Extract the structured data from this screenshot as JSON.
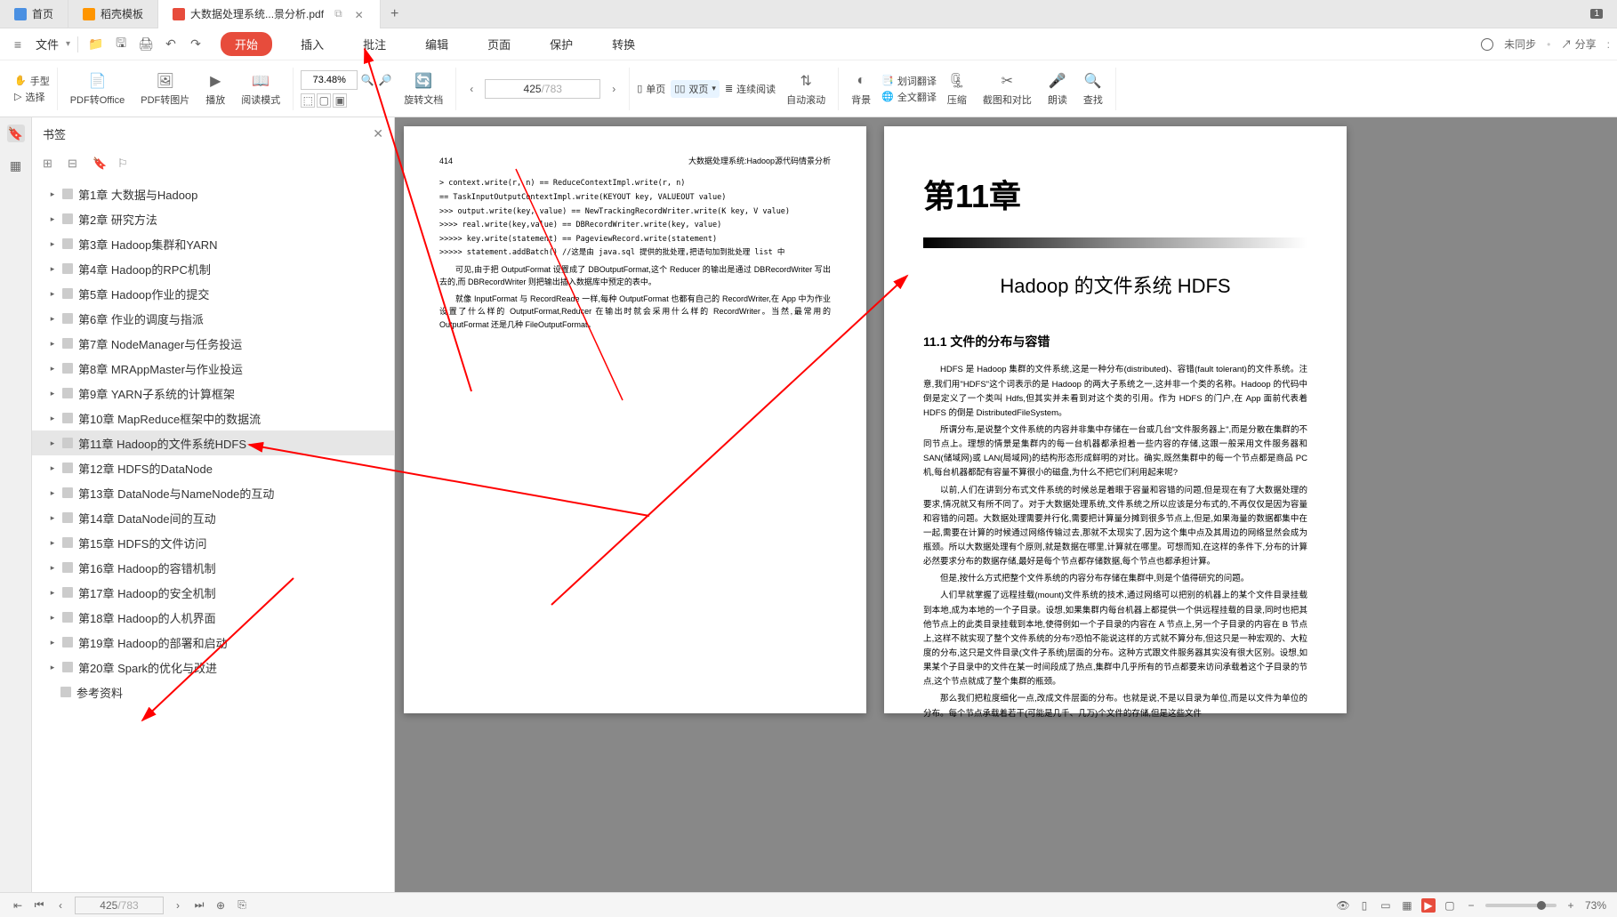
{
  "tabs": {
    "home": "首页",
    "template": "稻壳模板",
    "pdf": "大数据处理系统...景分析.pdf"
  },
  "menu": {
    "file": "文件",
    "tabs": [
      "开始",
      "插入",
      "批注",
      "编辑",
      "页面",
      "保护",
      "转换"
    ],
    "sync": "未同步",
    "share": "分享"
  },
  "toolbar": {
    "hand": "手型",
    "select": "选择",
    "pdf_to_office": "PDF转Office",
    "pdf_to_image": "PDF转图片",
    "play": "播放",
    "read_mode": "阅读模式",
    "zoom": "73.48%",
    "rotate": "旋转文档",
    "page_current": "425",
    "page_total": "/783",
    "single_page": "单页",
    "double_page": "双页",
    "continuous": "连续阅读",
    "auto_scroll": "自动滚动",
    "background": "背景",
    "word_translate": "划词翻译",
    "full_translate": "全文翻译",
    "compress": "压缩",
    "screenshot": "截图和对比",
    "read_aloud": "朗读",
    "find": "查找"
  },
  "bookmarks": {
    "title": "书签",
    "items": [
      "第1章  大数据与Hadoop",
      "第2章  研究方法",
      "第3章  Hadoop集群和YARN",
      "第4章  Hadoop的RPC机制",
      "第5章  Hadoop作业的提交",
      "第6章  作业的调度与指派",
      "第7章  NodeManager与任务投运",
      "第8章  MRAppMaster与作业投运",
      "第9章  YARN子系统的计算框架",
      "第10章  MapReduce框架中的数据流",
      "第11章  Hadoop的文件系统HDFS",
      "第12章  HDFS的DataNode",
      "第13章  DataNode与NameNode的互动",
      "第14章  DataNode间的互动",
      "第15章  HDFS的文件访问",
      "第16章  Hadoop的容错机制",
      "第17章  Hadoop的安全机制",
      "第18章  Hadoop的人机界面",
      "第19章  Hadoop的部署和启动",
      "第20章  Spark的优化与改进"
    ],
    "ref": "参考资料",
    "selected_index": 10
  },
  "pdf_left": {
    "page_num": "414",
    "header": "大数据处理系统:Hadoop源代码情景分析",
    "code": [
      "> context.write(r, n) == ReduceContextImpl.write(r, n)",
      "  == TaskInputOutputContextImpl.write(KEYOUT key, VALUEOUT value)",
      ">>> output.write(key, value) == NewTrackingRecordWriter.write(K key, V value)",
      ">>>> real.write(key,value) == DBRecordWriter.write(key, value)",
      ">>>>> key.write(statement) == PageviewRecord.write(statement)",
      ">>>>> statement.addBatch()   //这是由 java.sql 提供的批处理,把语句加到批处理 list 中"
    ],
    "paras": [
      "可见,由于把 OutputFormat 设置成了 DBOutputFormat,这个 Reducer 的输出是通过 DBRecordWriter 写出去的,而 DBRecordWriter 则把输出插入数据库中预定的表中。",
      "就像 InputFormat 与 RecordReade 一样,每种 OutputFormat 也都有自己的 RecordWriter,在 App 中为作业设置了什么样的 OutputFormat,Reducer 在输出时就会采用什么样的 RecordWriter。当然,最常用的 OutputFormat 还是几种 FileOutputFormat。"
    ]
  },
  "pdf_right": {
    "chapter": "第11章",
    "title": "Hadoop 的文件系统 HDFS",
    "section": "11.1  文件的分布与容错",
    "paras": [
      "HDFS 是 Hadoop 集群的文件系统,这是一种分布(distributed)、容错(fault tolerant)的文件系统。注意,我们用\"HDFS\"这个词表示的是 Hadoop 的两大子系统之一,这并非一个类的名称。Hadoop 的代码中倒是定义了一个类叫 Hdfs,但其实并未看到对这个类的引用。作为 HDFS 的门户,在 App 面前代表着 HDFS 的倒是 DistributedFileSystem。",
      "所谓分布,是说整个文件系统的内容并非集中存储在一台或几台\"文件服务器上\",而是分散在集群的不同节点上。理想的情景是集群内的每一台机器都承担着一些内容的存储,这跟一般采用文件服务器和SAN(储域网)或 LAN(局域网)的结构形态形成鲜明的对比。确实,既然集群中的每一个节点都是商品 PC 机,每台机器都配有容量不算很小的磁盘,为什么不把它们利用起来呢?",
      "以前,人们在讲到分布式文件系统的时候总是着眼于容量和容错的问题,但是现在有了大数据处理的要求,情况就又有所不同了。对于大数据处理系统,文件系统之所以应该是分布式的,不再仅仅是因为容量和容错的问题。大数据处理需要并行化,需要把计算量分摊到很多节点上,但是,如果海量的数据都集中在一起,需要在计算的时候通过网络传输过去,那就不太现实了,因为这个集中点及其周边的网络显然会成为瓶颈。所以大数据处理有个原则,就是数据在哪里,计算就在哪里。可想而知,在这样的条件下,分布的计算必然要求分布的数据存储,最好是每个节点都存储数据,每个节点也都承担计算。",
      "但是,按什么方式把整个文件系统的内容分布存储在集群中,则是个值得研究的问题。",
      "人们早就掌握了远程挂载(mount)文件系统的技术,通过网络可以把别的机器上的某个文件目录挂载到本地,成为本地的一个子目录。设想,如果集群内每台机器上都提供一个供远程挂载的目录,同时也把其他节点上的此类目录挂载到本地,使得例如一个子目录的内容在 A 节点上,另一个子目录的内容在 B 节点上,这样不就实现了整个文件系统的分布?恐怕不能说这样的方式就不算分布,但这只是一种宏观的、大粒度的分布,这只是文件目录(文件子系统)层面的分布。这种方式跟文件服务器其实没有很大区别。设想,如果某个子目录中的文件在某一时间段成了热点,集群中几乎所有的节点都要来访问承载着这个子目录的节点,这个节点就成了整个集群的瓶颈。",
      "那么我们把粒度细化一点,改成文件层面的分布。也就是说,不是以目录为单位,而是以文件为单位的分布。每个节点承载着若干(可能是几千、几万)个文件的存储,但是这些文件"
    ]
  },
  "statusbar": {
    "page_current": "425",
    "page_total": "/783",
    "zoom": "73%"
  }
}
